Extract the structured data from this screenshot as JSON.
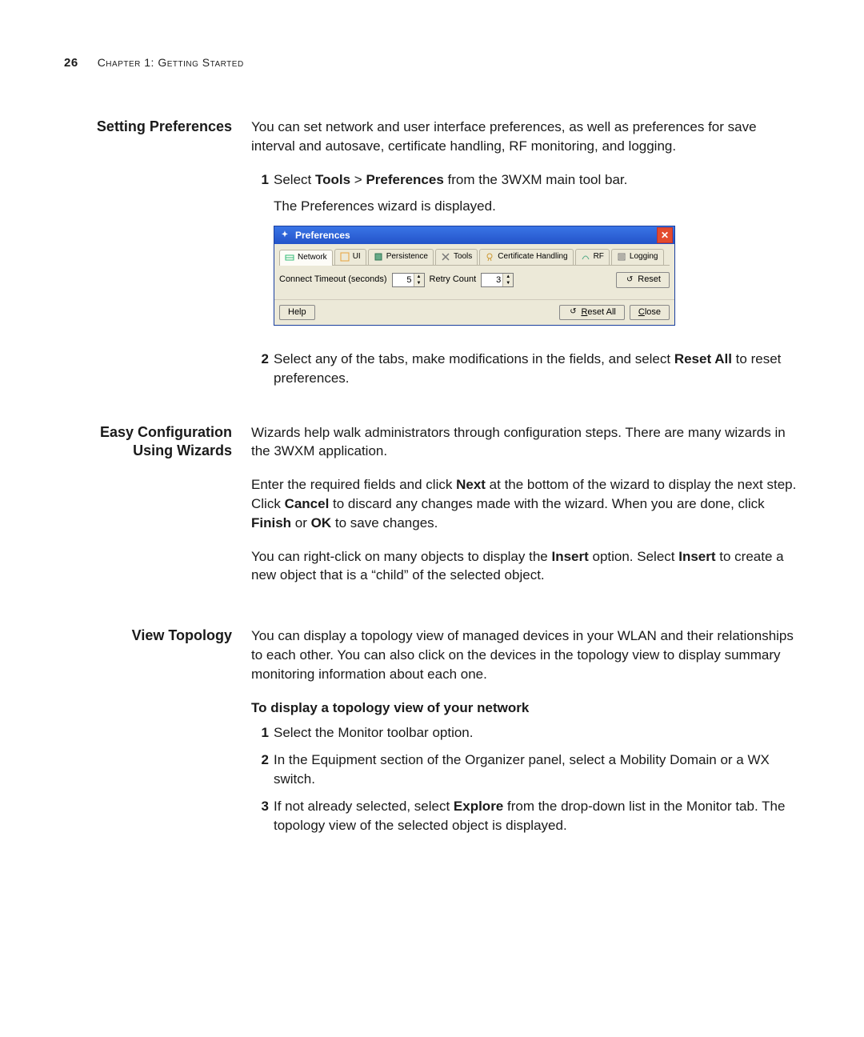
{
  "header": {
    "page_number": "26",
    "chapter_line": "Chapter 1: Getting Started"
  },
  "sections": {
    "setting_prefs": {
      "heading": "Setting Preferences",
      "intro": "You can set network and user interface preferences, as well as preferences for save interval and autosave, certificate handling, RF monitoring, and logging.",
      "step1_before_bold": "Select ",
      "step1_bold1": "Tools",
      "step1_gt": " > ",
      "step1_bold2": "Preferences",
      "step1_after": " from the 3WXM main tool bar.",
      "step1_result": "The Preferences wizard is displayed.",
      "step2_a": "Select any of the tabs, make modifications in the fields, and select ",
      "step2_bold": "Reset All",
      "step2_b": " to reset preferences."
    },
    "easy_cfg": {
      "heading": "Easy Configuration Using Wizards",
      "p1": "Wizards help walk administrators through configuration steps. There are many wizards in the 3WXM application.",
      "p2_a": "Enter the required fields and click ",
      "p2_next": "Next",
      "p2_b": " at the bottom of the wizard to display the next step. Click ",
      "p2_cancel": "Cancel",
      "p2_c": " to discard any changes made with the wizard. When you are done, click ",
      "p2_finish": "Finish",
      "p2_or": " or ",
      "p2_ok": "OK",
      "p2_d": " to save changes.",
      "p3_a": "You can right-click on many objects to display the ",
      "p3_insert1": "Insert",
      "p3_b": " option. Select ",
      "p3_insert2": "Insert",
      "p3_c": " to create a new object that is a “child” of the selected object."
    },
    "view_topo": {
      "heading": "View Topology",
      "p1": "You can display a topology view of managed devices in your WLAN and their relationships to each other. You can also click on the devices in the topology view to display summary monitoring information about each one.",
      "sub": "To display a topology view of your network",
      "s1": "Select the Monitor toolbar option.",
      "s2": "In the Equipment section of the Organizer panel, select a Mobility Domain or a WX switch.",
      "s3_a": "If not already selected, select ",
      "s3_bold": "Explore",
      "s3_b": " from the drop-down list in the Monitor tab. The topology view of the selected object is displayed."
    }
  },
  "dialog": {
    "title": "Preferences",
    "tabs": {
      "network": "Network",
      "ui": "UI",
      "persistence": "Persistence",
      "tools": "Tools",
      "cert": "Certificate Handling",
      "rf": "RF",
      "logging": "Logging"
    },
    "labels": {
      "connect_timeout": "Connect Timeout (seconds)",
      "retry_count": "Retry Count"
    },
    "values": {
      "connect_timeout": "5",
      "retry_count": "3"
    },
    "buttons": {
      "reset": "Reset",
      "help": "Help",
      "reset_all_pre": "R",
      "reset_all_post": "eset All",
      "close_pre": "C",
      "close_post": "lose"
    }
  }
}
